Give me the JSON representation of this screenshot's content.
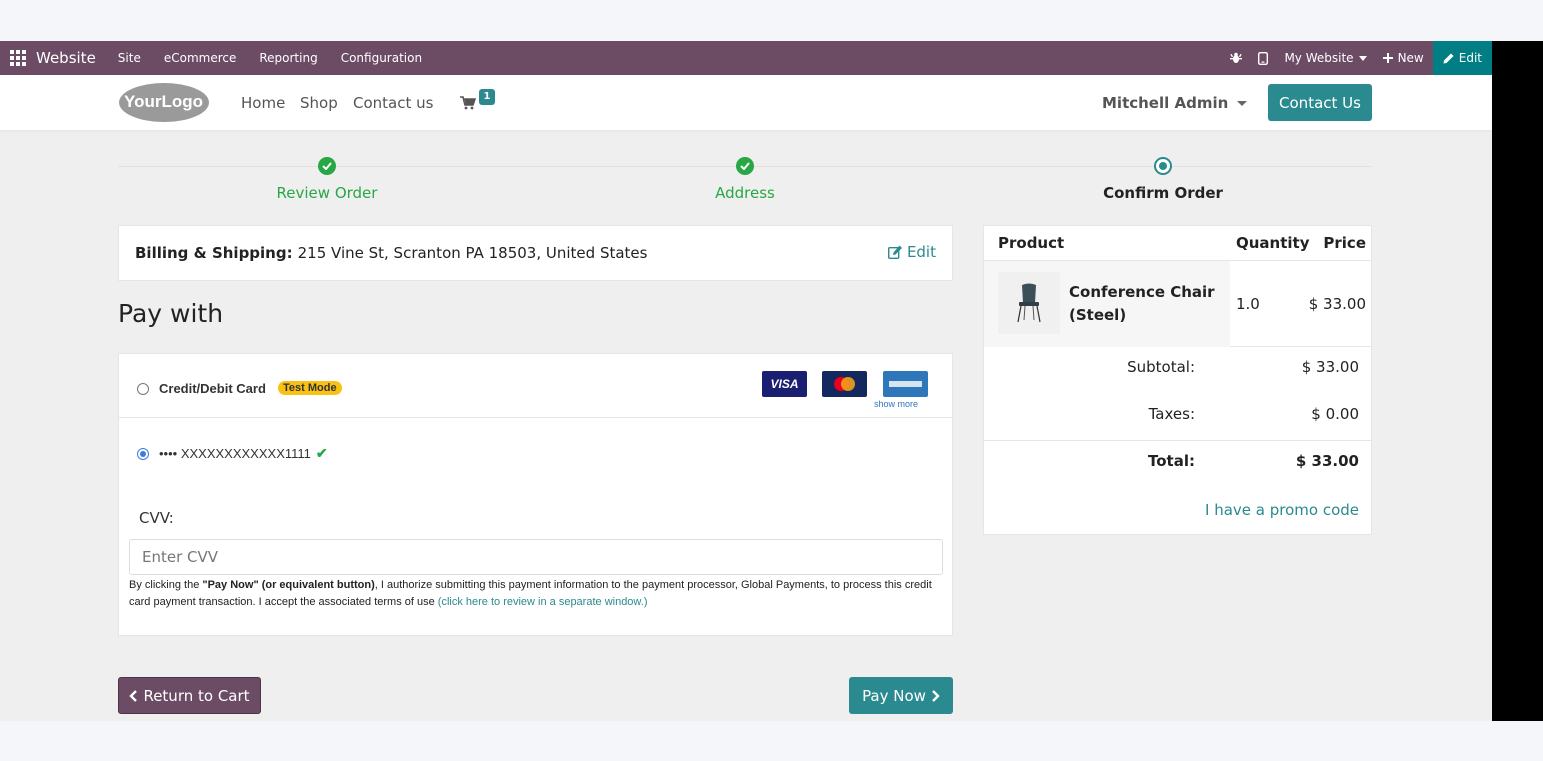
{
  "adminbar": {
    "brand": "Website",
    "menu": [
      "Site",
      "eCommerce",
      "Reporting",
      "Configuration"
    ],
    "website_selector": "My Website",
    "new_label": "New",
    "edit_label": "Edit"
  },
  "header": {
    "logo_text": "YourLogo",
    "nav": [
      "Home",
      "Shop",
      "Contact us"
    ],
    "cart_count": "1",
    "user": "Mitchell Admin",
    "contact_button": "Contact Us"
  },
  "steps": [
    {
      "label": "Review Order",
      "state": "done"
    },
    {
      "label": "Address",
      "state": "done"
    },
    {
      "label": "Confirm Order",
      "state": "current"
    }
  ],
  "billing": {
    "label": "Billing & Shipping:",
    "address": "215 Vine St, Scranton PA 18503, United States",
    "edit_label": "Edit"
  },
  "payment": {
    "heading": "Pay with",
    "option1": {
      "name": "Credit/Debit Card",
      "badge": "Test Mode",
      "selected": false
    },
    "card_logos": [
      "VISA",
      "MasterCard",
      "AMERICAN EXPRESS"
    ],
    "show_more": "show more",
    "option2": {
      "name": "•••• XXXXXXXXXXXX1111",
      "selected": true
    },
    "cvv_label": "CVV:",
    "cvv_placeholder": "Enter CVV",
    "legal_prefix": "By clicking the ",
    "legal_bold": "\"Pay Now\" (or equivalent button)",
    "legal_mid": ", I authorize submitting this payment information to the payment processor, Global Payments, to process this credit card payment transaction. I accept the associated terms of use ",
    "legal_link": "(click here to review in a separate window.)"
  },
  "buttons": {
    "back": "Return to Cart",
    "pay": "Pay Now"
  },
  "summary": {
    "headers": [
      "Product",
      "Quantity",
      "Price"
    ],
    "item": {
      "name": "Conference Chair (Steel)",
      "quantity": "1.0",
      "price": "$ 33.00"
    },
    "subtotal_label": "Subtotal:",
    "subtotal": "$ 33.00",
    "taxes_label": "Taxes:",
    "taxes": "$ 0.00",
    "total_label": "Total:",
    "total": "$ 33.00",
    "promo": "I have a promo code"
  },
  "colors": {
    "admin_bar": "#6c4c65",
    "primary": "#2b8a8f",
    "success": "#28a745",
    "badge": "#f8c113"
  }
}
